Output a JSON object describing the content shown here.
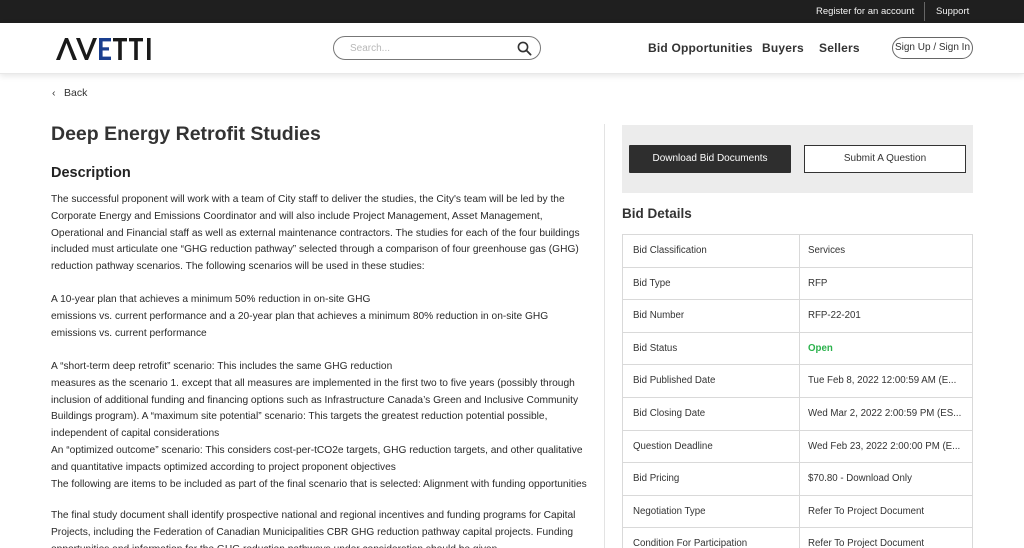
{
  "topbar": {
    "register": "Register for an account",
    "support": "Support"
  },
  "header": {
    "logo": "AVETTI",
    "search_placeholder": "Search...",
    "nav": [
      "Bid Opportunities",
      "Buyers",
      "Sellers"
    ],
    "signin": "Sign Up / Sign In"
  },
  "back": "Back",
  "title": "Deep Energy Retrofit Studies",
  "description_heading": "Description",
  "description": {
    "p1": "The successful proponent will work with a team of City staff to deliver the studies, the City's team will be led by the Corporate Energy and Emissions Coordinator and will also include Project Management, Asset Management, Operational and Financial staff as well as external maintenance contractors. The studies for each of the four buildings included must articulate one “GHG reduction pathway” selected through a comparison of four greenhouse gas (GHG) reduction pathway scenarios. The following scenarios will be used in these studies:",
    "p2_line1": "A 10-year plan that achieves a minimum 50% reduction in on-site GHG",
    "p2_line2": "emissions vs. current performance and a 20-year plan that achieves a minimum 80% reduction in on-site GHG emissions vs. current performance",
    "p3_line1": "A “short-term deep retrofit” scenario: This includes the same GHG reduction",
    "p3_line2": "measures as the scenario 1. except that all measures are implemented in the first two to five years (possibly through inclusion of additional funding and financing options such as Infrastructure Canada’s Green and Inclusive Community Buildings program). A “maximum site potential” scenario: This targets the greatest reduction potential possible, independent of capital considerations",
    "p3_line3": "An “optimized outcome” scenario: This considers cost-per-tCO2e targets, GHG reduction targets, and other qualitative and quantitative impacts optimized according to project proponent objectives",
    "p3_line4": "The following are items to be included as part of the final scenario that is selected: Alignment with funding opportunities",
    "p4": "The final study document shall identify prospective national and regional incentives and funding programs for Capital Projects, including the Federation of Canadian Municipalities CBR GHG reduction pathway capital projects. Funding opportunities and information for the GHG reduction pathways under consideration should be given"
  },
  "actions": {
    "download": "Download Bid Documents",
    "question": "Submit A Question"
  },
  "details_heading": "Bid Details",
  "details": [
    {
      "key": "Bid Classification",
      "value": "Services"
    },
    {
      "key": "Bid Type",
      "value": "RFP"
    },
    {
      "key": "Bid Number",
      "value": "RFP-22-201"
    },
    {
      "key": "Bid Status",
      "value": "Open"
    },
    {
      "key": "Bid Published Date",
      "value": "Tue Feb 8, 2022 12:00:59 AM (E..."
    },
    {
      "key": "Bid Closing Date",
      "value": "Wed Mar 2, 2022 2:00:59 PM (ES..."
    },
    {
      "key": "Question Deadline",
      "value": "Wed Feb 23, 2022 2:00:00 PM (E..."
    },
    {
      "key": "Bid Pricing",
      "value": "$70.80 - Download Only"
    },
    {
      "key": "Negotiation Type",
      "value": "Refer To Project Document"
    },
    {
      "key": "Condition For Participation",
      "value": "Refer To Project Document"
    }
  ],
  "colors": {
    "open_status": "#2bb24c",
    "topbar": "#1f1f1f",
    "primary_button": "#2e2e2e"
  }
}
